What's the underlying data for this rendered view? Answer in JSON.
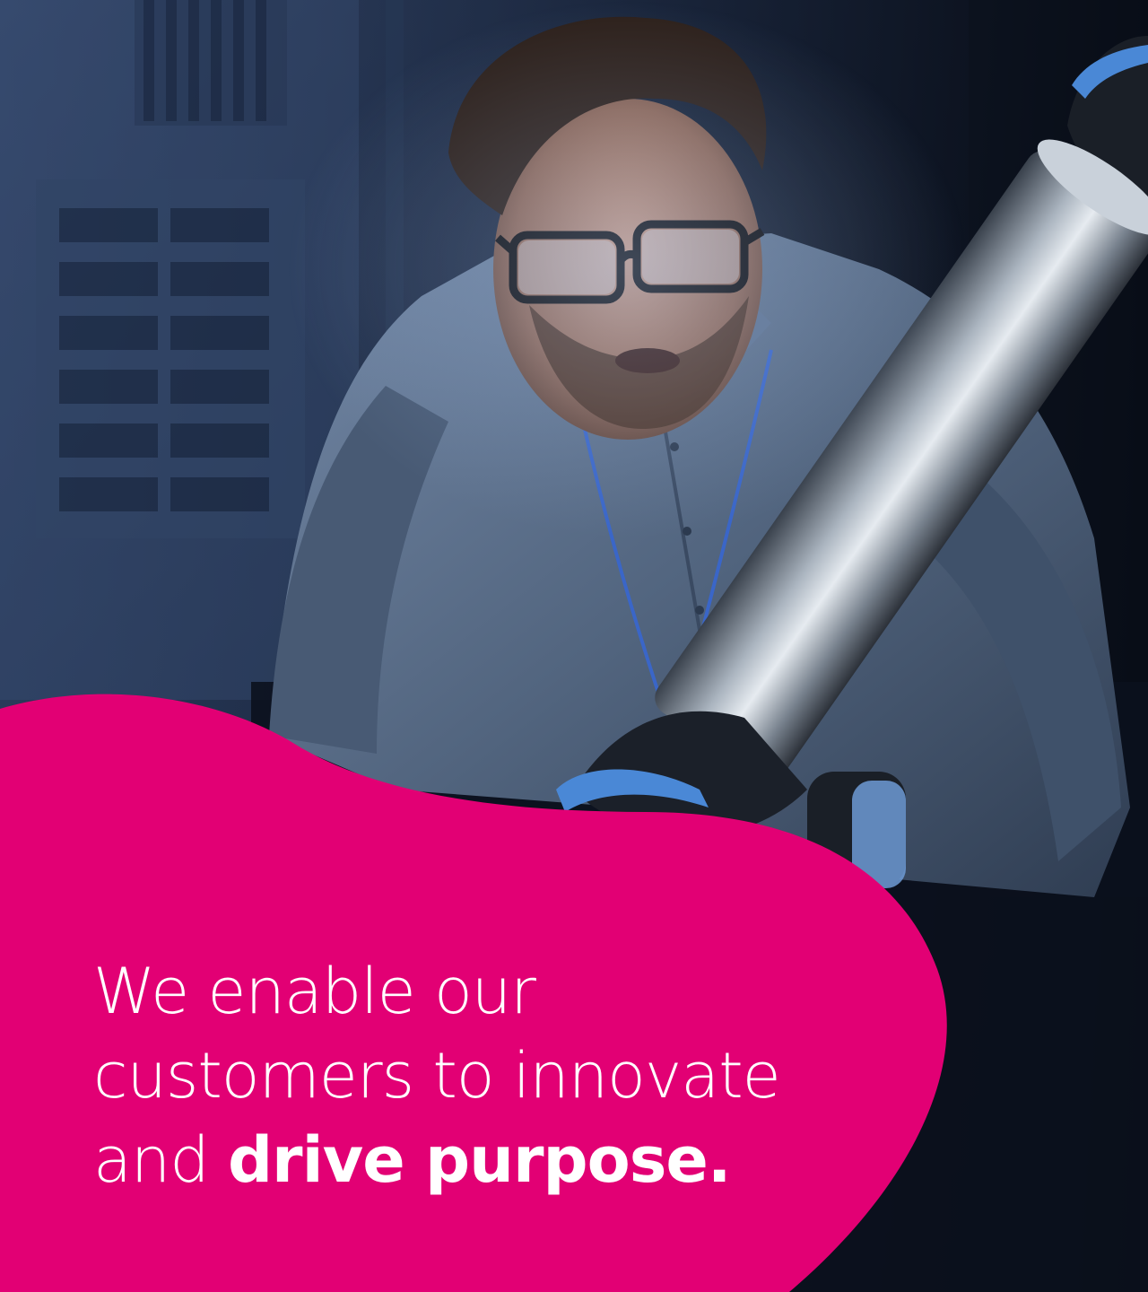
{
  "colors": {
    "brand_magenta": "#E20074",
    "background_dark": "#0F1726",
    "text": "#FFFFFF"
  },
  "image": {
    "description_icon": "photo-engineer-robotic-arm"
  },
  "headline": {
    "regular_part": "We enable our customers to innovate and ",
    "bold_part": "drive purpose."
  }
}
